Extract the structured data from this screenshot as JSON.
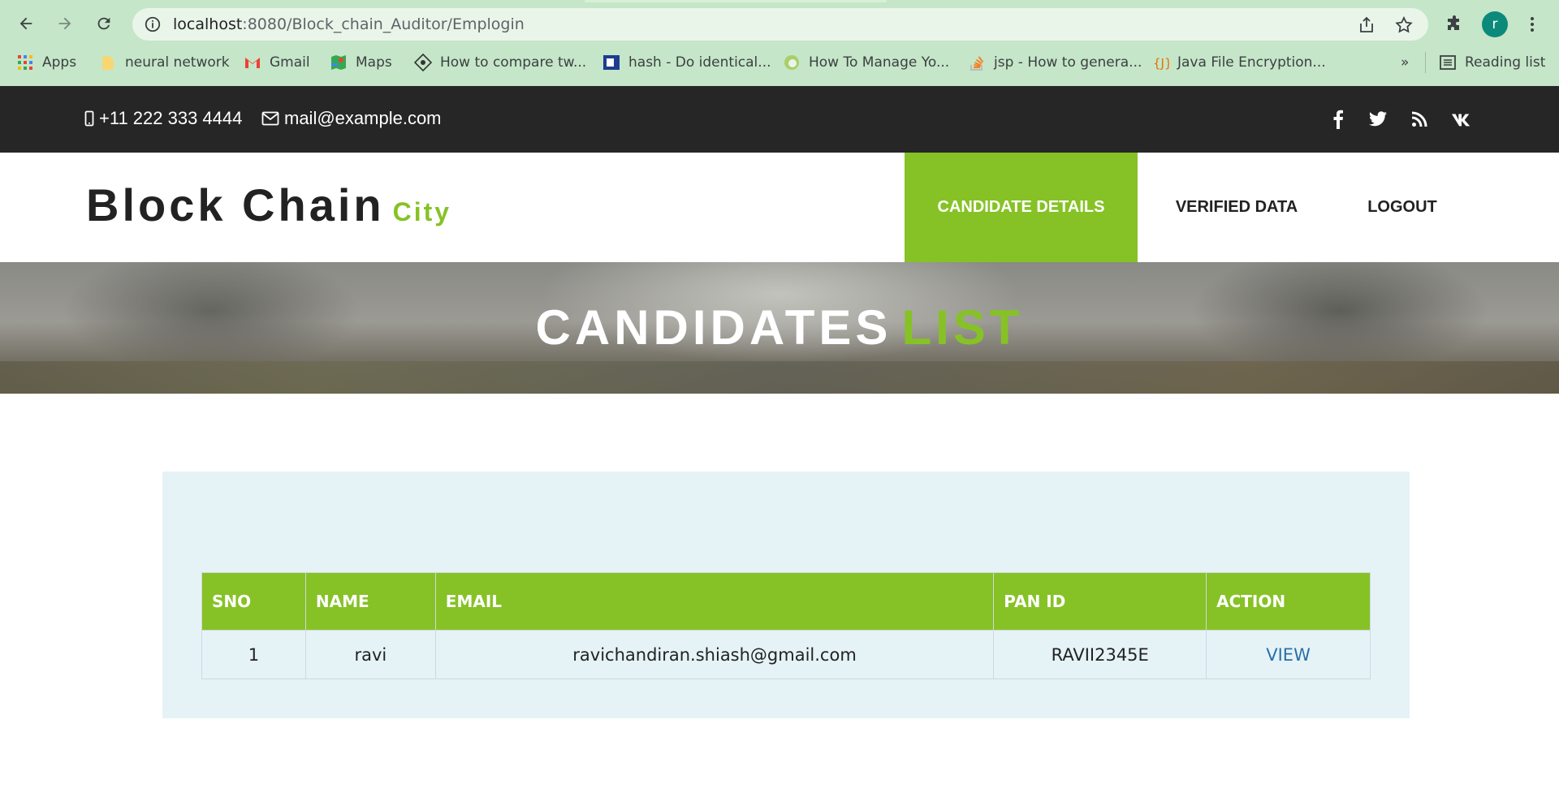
{
  "browser": {
    "url_host": "localhost",
    "url_rest": ":8080/Block_chain_Auditor/Emplogin",
    "profile_initial": "r",
    "bookmarks": [
      {
        "label": "Apps",
        "icon": "apps-grid-icon"
      },
      {
        "label": "neural network",
        "icon": "folder-icon"
      },
      {
        "label": "Gmail",
        "icon": "gmail-icon"
      },
      {
        "label": "Maps",
        "icon": "maps-icon"
      },
      {
        "label": "How to compare tw...",
        "icon": "site-icon"
      },
      {
        "label": "hash - Do identical...",
        "icon": "site-icon"
      },
      {
        "label": "How To Manage Yo...",
        "icon": "site-icon"
      },
      {
        "label": "jsp - How to genera...",
        "icon": "stackoverflow-icon"
      },
      {
        "label": "Java File Encryption...",
        "icon": "java-icon"
      }
    ],
    "more_bookmarks": "»",
    "reading_list": "Reading list"
  },
  "topbar": {
    "phone": "+11 222 333 4444",
    "email": "mail@example.com",
    "social": [
      "facebook-icon",
      "twitter-icon",
      "rss-icon",
      "vk-icon"
    ]
  },
  "header": {
    "logo_main": "Block Chain",
    "logo_sub": "City",
    "nav": [
      {
        "label": "CANDIDATE DETAILS",
        "active": true
      },
      {
        "label": "VERIFIED DATA",
        "active": false
      },
      {
        "label": "LOGOUT",
        "active": false
      }
    ]
  },
  "banner": {
    "title_white": "CANDIDATES",
    "title_green": "LIST"
  },
  "table": {
    "columns": [
      "SNO",
      "NAME",
      "EMAIL",
      "PAN ID",
      "ACTION"
    ],
    "rows": [
      {
        "sno": "1",
        "name": "ravi",
        "email": "ravichandiran.shiash@gmail.com",
        "pan_id": "RAVII2345E",
        "action": "VIEW"
      }
    ]
  },
  "colors": {
    "accent_green": "#86c226",
    "topbar_bg": "#262626",
    "panel_bg": "#e5f3f7",
    "link_blue": "#2a6fa8"
  }
}
